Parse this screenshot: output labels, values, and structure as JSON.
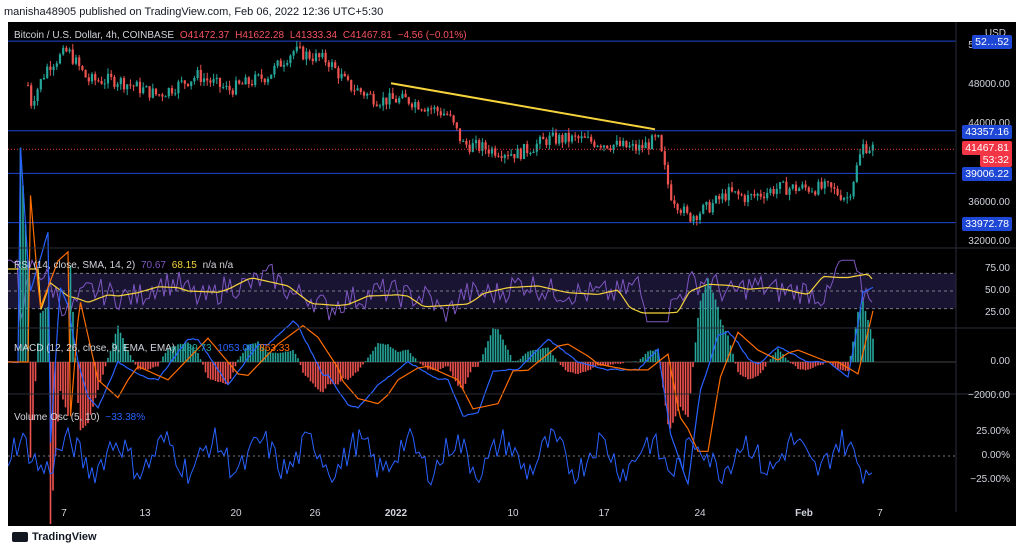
{
  "header": {
    "text": "manisha48905 published on TradingView.com, Feb 06, 2022 12:36 UTC+5:30"
  },
  "main": {
    "title": "Bitcoin / U.S. Dollar, 4h, COINBASE",
    "o": "O41472.37",
    "h": "H41622.28",
    "l": "L41333.34",
    "c": "C41467.81",
    "chg": "−4.56 (−0.01%)",
    "currency": "USD"
  },
  "price_axis": [
    "52000.00",
    "48000.00",
    "44000.00",
    "36000.00",
    "32000.00"
  ],
  "price_boxes": [
    {
      "label": "52…52",
      "color": "#1e47d6"
    },
    {
      "label": "43357.16",
      "color": "#1e47d6"
    },
    {
      "label": "41467.81",
      "color": "#f23645"
    },
    {
      "label": "53:32",
      "color": "#f23645"
    },
    {
      "label": "39006.22",
      "color": "#1e47d6"
    },
    {
      "label": "33972.78",
      "color": "#1e47d6"
    }
  ],
  "rsi": {
    "title": "RSI (14, close, SMA, 14, 2)",
    "v1": "70.67",
    "v2": "68.15",
    "v3": "n/a  n/a",
    "axis": [
      "75.00",
      "50.00",
      "25.00"
    ]
  },
  "macd": {
    "title": "MACD (12, 26, close, 9, EMA, EMA)",
    "v1": "189.73",
    "v2": "1053.06",
    "v3": "863.33",
    "axis": [
      "0.00",
      "−2000.00"
    ]
  },
  "vol": {
    "title": "Volume Osc (5, 10)",
    "v1": "−33.38%",
    "axis": [
      "25.00%",
      "0.00%",
      "−25.00%"
    ]
  },
  "x_axis": [
    "7",
    "13",
    "20",
    "26",
    "2022",
    "10",
    "17",
    "24",
    "Feb",
    "7"
  ],
  "footer": {
    "brand": "TradingView"
  },
  "colors": {
    "up": "#26a69a",
    "down": "#ef5350",
    "hline": "#1e47d6",
    "trend": "#f5d33c",
    "rsi": "#7e57c2",
    "macd": "#2962ff",
    "signal": "#ff6d00"
  }
}
